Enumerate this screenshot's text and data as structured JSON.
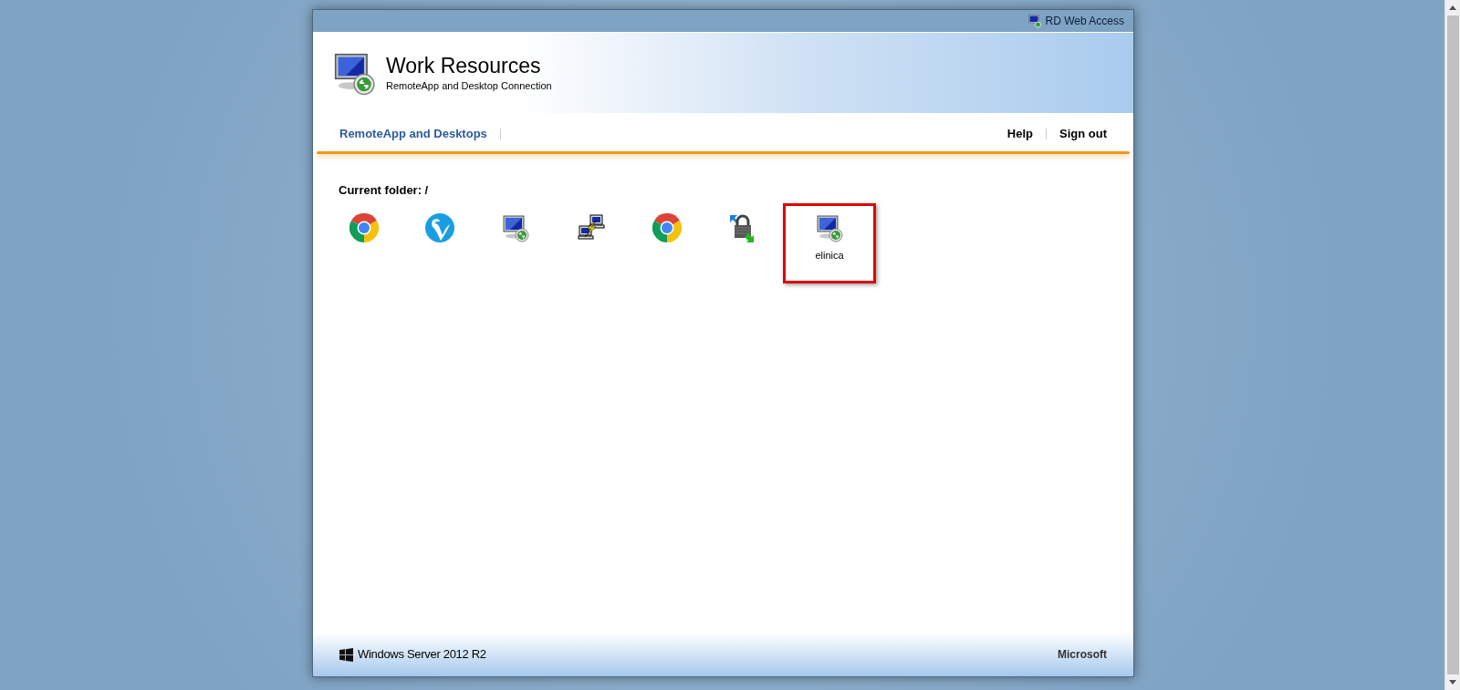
{
  "top_bar": {
    "title": "RD Web Access"
  },
  "header": {
    "title": "Work Resources",
    "subtitle": "RemoteApp and Desktop Connection"
  },
  "nav": {
    "left": [
      {
        "label": "RemoteApp and Desktops",
        "selected": true
      }
    ],
    "right": [
      {
        "label": "Help"
      },
      {
        "label": "Sign out"
      }
    ]
  },
  "content": {
    "current_folder": "Current folder: /",
    "items": [
      {
        "kind": "chrome",
        "highlighted": false
      },
      {
        "kind": "bird",
        "highlighted": false
      },
      {
        "kind": "remote",
        "highlighted": false
      },
      {
        "kind": "putty",
        "highlighted": false
      },
      {
        "kind": "chrome",
        "highlighted": false
      },
      {
        "kind": "lock",
        "highlighted": false
      },
      {
        "kind": "remote",
        "label": "elinica",
        "highlighted": true
      }
    ]
  },
  "footer": {
    "left": "Windows Server 2012 R2",
    "right": "Microsoft"
  }
}
